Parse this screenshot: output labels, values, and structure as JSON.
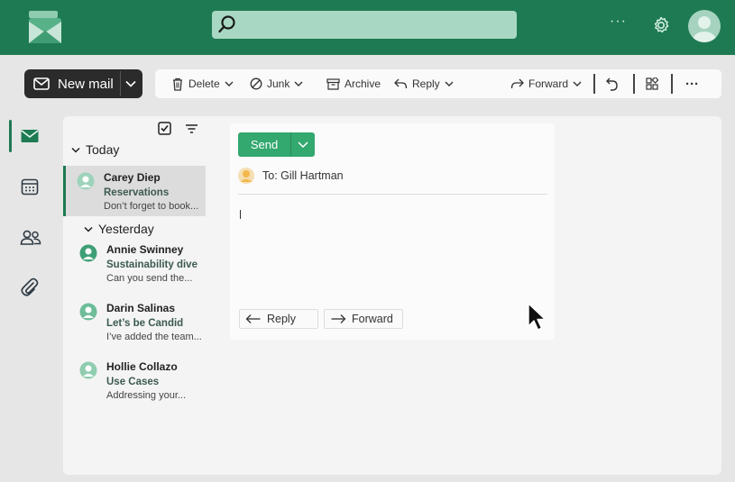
{
  "colors": {
    "brand": "#1e7a52",
    "send": "#33a86f",
    "search_bg": "#a8d8c3"
  },
  "header": {
    "logo_icon": "mail-logo-icon",
    "search_placeholder": "",
    "more_label": "···",
    "settings_icon": "gear-icon",
    "avatar_icon": "user-avatar-icon"
  },
  "new_mail": {
    "label": "New mail",
    "icon": "envelope-icon"
  },
  "toolbar": {
    "delete": "Delete",
    "junk": "Junk",
    "archive": "Archive",
    "reply": "Reply",
    "forward": "Forward",
    "more": "···"
  },
  "rail": [
    "mail-icon",
    "calendar-icon",
    "people-icon",
    "attachment-icon"
  ],
  "mail_list": {
    "groups": [
      {
        "label": "Today"
      },
      {
        "label": "Yesterday"
      }
    ],
    "items": [
      {
        "from": "Carey Diep",
        "subject": "Reservations",
        "preview": "Don’t forget to book..."
      },
      {
        "from": "Annie Swinney",
        "subject": "Sustainability dive",
        "preview": "Can you send the..."
      },
      {
        "from": "Darin Salinas",
        "subject": "Let’s be Candid",
        "preview": "I’ve added the team..."
      },
      {
        "from": "Hollie Collazo",
        "subject": "Use Cases",
        "preview": "Addressing your..."
      }
    ]
  },
  "compose": {
    "send_label": "Send",
    "to_text": "To: Gill Hartman",
    "reply_label": "Reply",
    "forward_label": "Forward"
  }
}
